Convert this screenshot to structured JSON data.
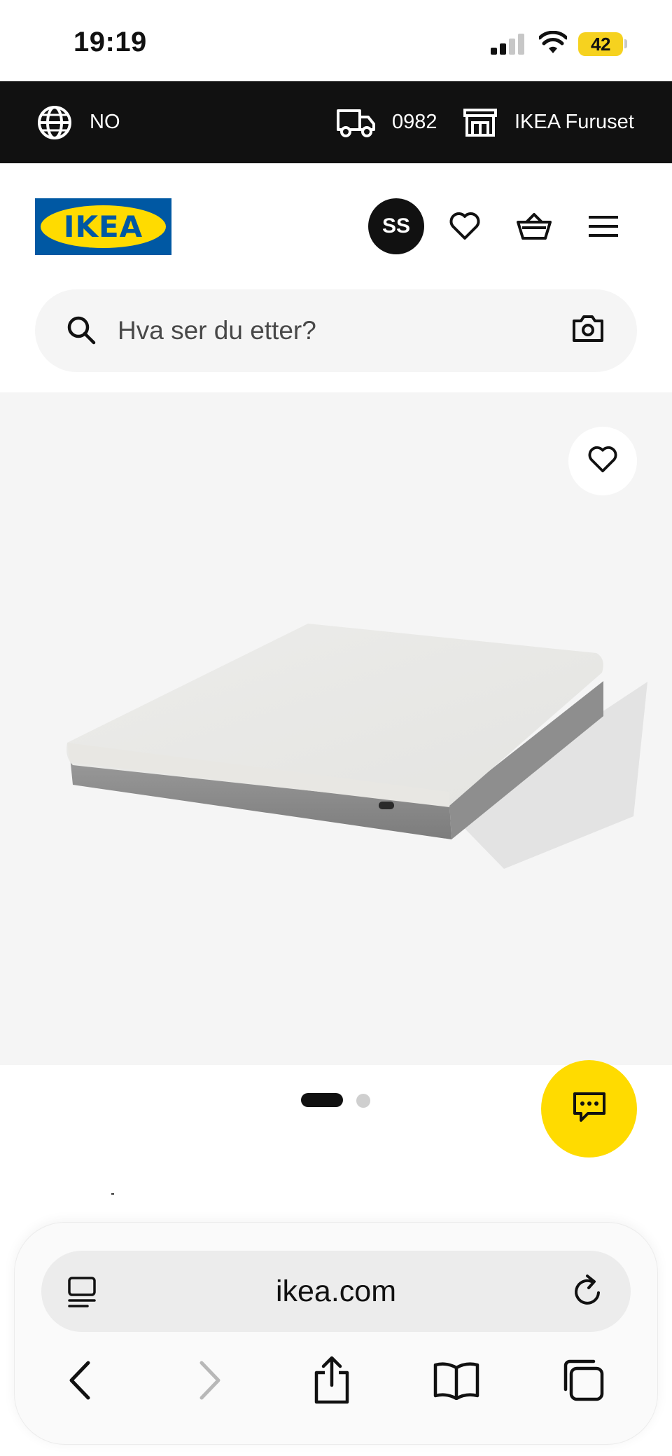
{
  "status_bar": {
    "time": "19:19",
    "battery": "42"
  },
  "top_bar": {
    "language": "NO",
    "postcode": "0982",
    "store": "IKEA Furuset"
  },
  "header": {
    "logo_text": "IKEA",
    "avatar_initials": "SS",
    "icons": [
      "heart-icon",
      "basket-icon",
      "menu-icon"
    ]
  },
  "search": {
    "placeholder": "Hva ser du etter?",
    "icons": [
      "search-icon",
      "camera-icon"
    ]
  },
  "product": {
    "favorite_icon": "heart-icon",
    "carousel_count": 2,
    "carousel_active_index": 0
  },
  "chat": {
    "icon": "chat-icon",
    "color": "#ffdb00"
  },
  "browser": {
    "url": "ikea.com",
    "nav_icons": [
      "back-icon",
      "forward-icon",
      "share-icon",
      "bookmarks-icon",
      "tabs-icon"
    ]
  },
  "colors": {
    "ikea_blue": "#0058a3",
    "ikea_yellow": "#ffdb00",
    "top_bar_bg": "#111111"
  }
}
